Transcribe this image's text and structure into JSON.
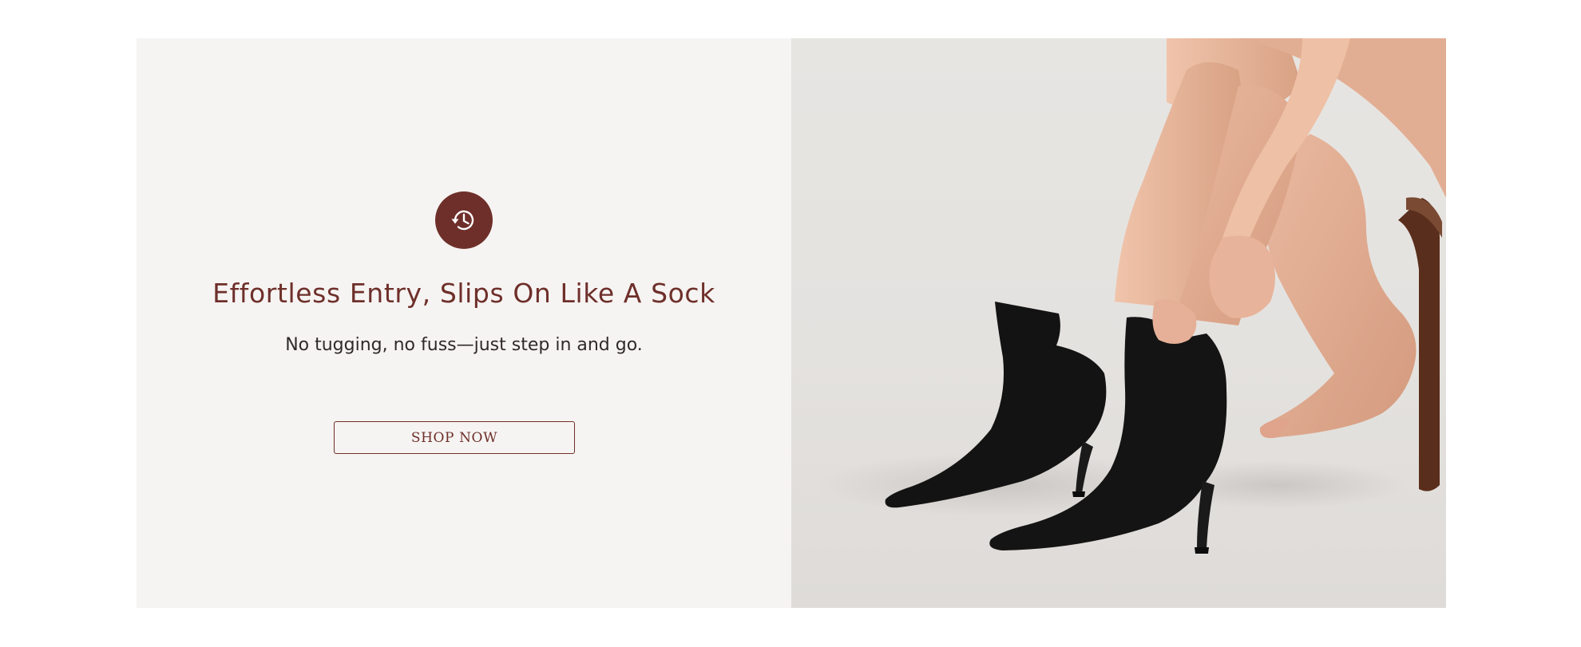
{
  "feature": {
    "icon": "history-clock-icon",
    "headline": "Effortless Entry, Slips On Like A Sock",
    "subtext": "No tugging, no fuss—just step in and go.",
    "cta_label": "SHOP NOW"
  },
  "image": {
    "subject": "woman-pulling-on-black-sock-boots"
  },
  "colors": {
    "accent": "#6e2f2a",
    "panel_bg": "#f6f4f2",
    "text_dark": "#2f2a28",
    "boot": "#141313"
  }
}
